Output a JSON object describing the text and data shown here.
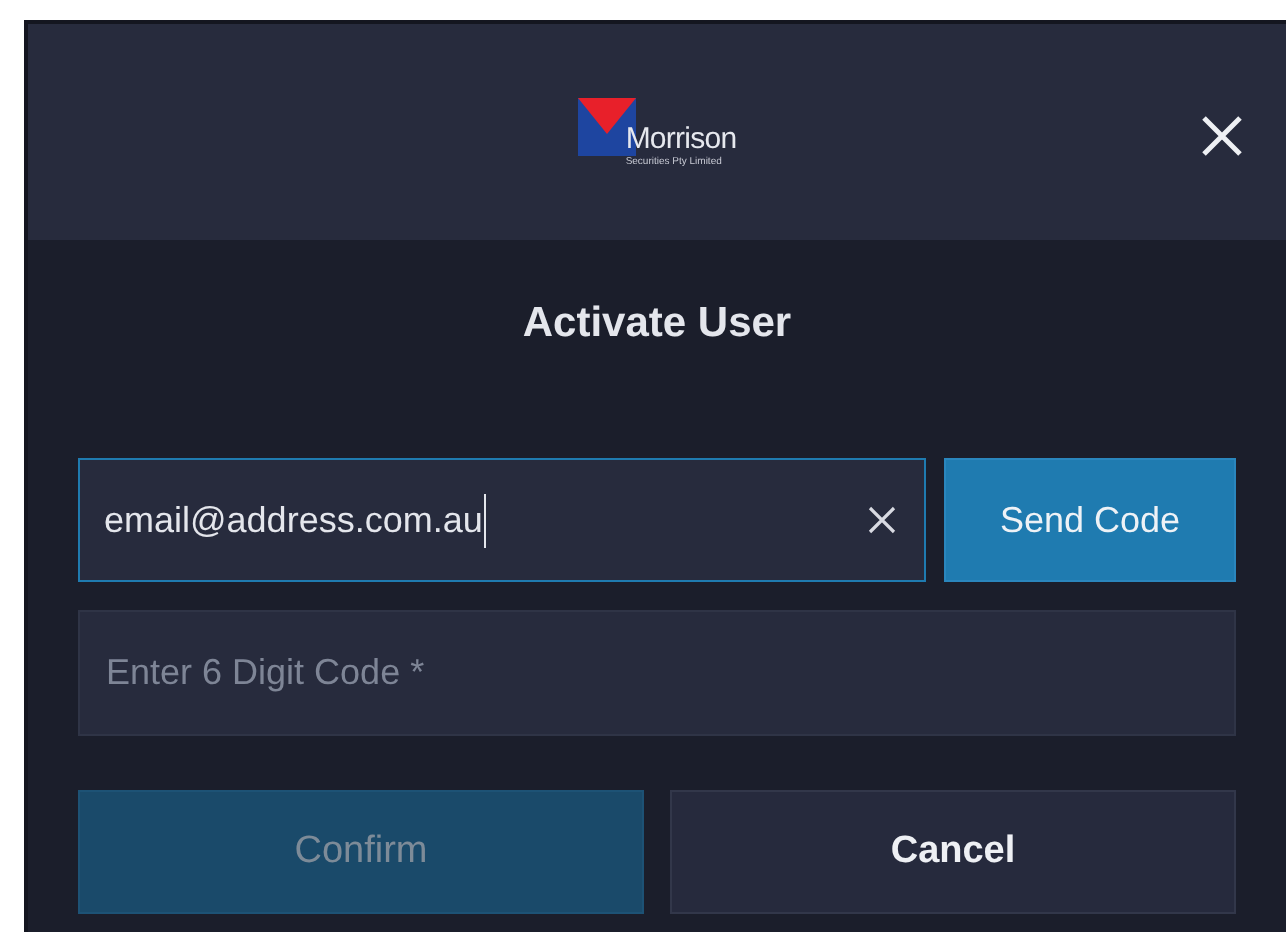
{
  "header": {
    "logo_name": "Morrison",
    "logo_tagline": "Securities Pty Limited"
  },
  "title": "Activate User",
  "email_field": {
    "value": "email@address.com.au",
    "focused": true
  },
  "send_code_button": "Send Code",
  "code_field": {
    "placeholder": "Enter 6 Digit Code *"
  },
  "buttons": [
    {
      "label": "Confirm",
      "kind": "primary",
      "disabled": true
    },
    {
      "label": "Cancel",
      "kind": "secondary",
      "disabled": false
    }
  ]
}
